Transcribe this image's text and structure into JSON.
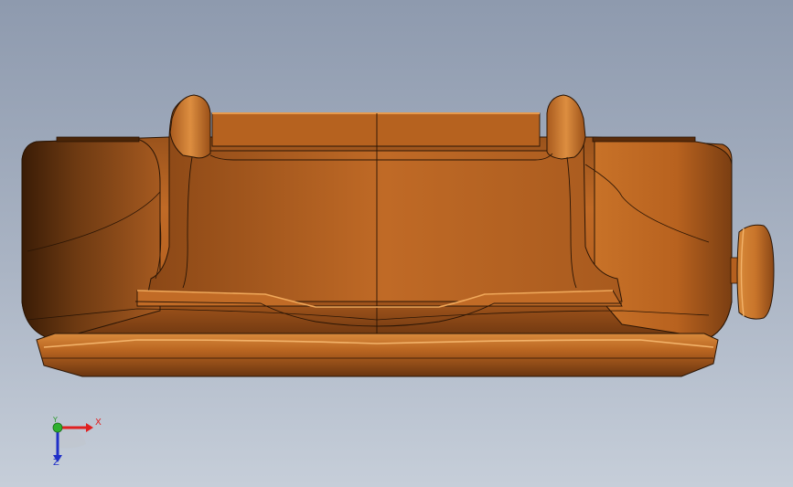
{
  "scene": {
    "model_color": "#c8742a",
    "background_top": "#8e9aae",
    "background_bottom": "#c6ced9"
  },
  "triad": {
    "x_label": "X",
    "y_label": "Y",
    "z_label": "Z",
    "x_color": "#e02020",
    "y_color": "#2a9a2a",
    "z_color": "#2030c8"
  }
}
